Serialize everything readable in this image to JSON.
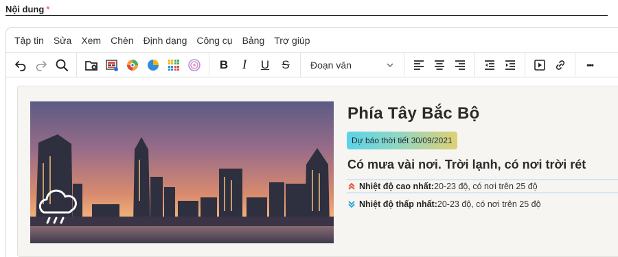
{
  "field": {
    "label": "Nội dung",
    "required_mark": "*"
  },
  "menubar": {
    "items": [
      "Tập tin",
      "Sửa",
      "Xem",
      "Chèn",
      "Định dạng",
      "Công cụ",
      "Bảng",
      "Trợ giúp"
    ]
  },
  "toolbar": {
    "undo": "undo-icon",
    "redo": "redo-icon",
    "find": "search-icon",
    "bold_label": "B",
    "italic_label": "I",
    "underline_label": "U",
    "strike_label": "S",
    "blocks_value": "Đoạn văn",
    "more_label": "•••"
  },
  "card": {
    "city": "Phía Tây Bắc Bộ",
    "badge": "Dự báo thời tiết 30/09/2021",
    "headline": "Có mưa vài nơi. Trời lạnh, có nơi trời rét",
    "high_label": "Nhiệt độ cao nhất:",
    "high_value": "20-23 độ, có nơi trên 25 độ",
    "low_label": "Nhiệt độ thấp nhất:",
    "low_value": " 20-23 độ, có nơi trên 25 độ"
  },
  "colors": {
    "required": "#e53935",
    "arrow_high": "#e8553a",
    "arrow_low": "#2fa8d8",
    "badge_gradient": [
      "#5bd2e8",
      "#8fd7c3",
      "#e0cf74"
    ]
  }
}
